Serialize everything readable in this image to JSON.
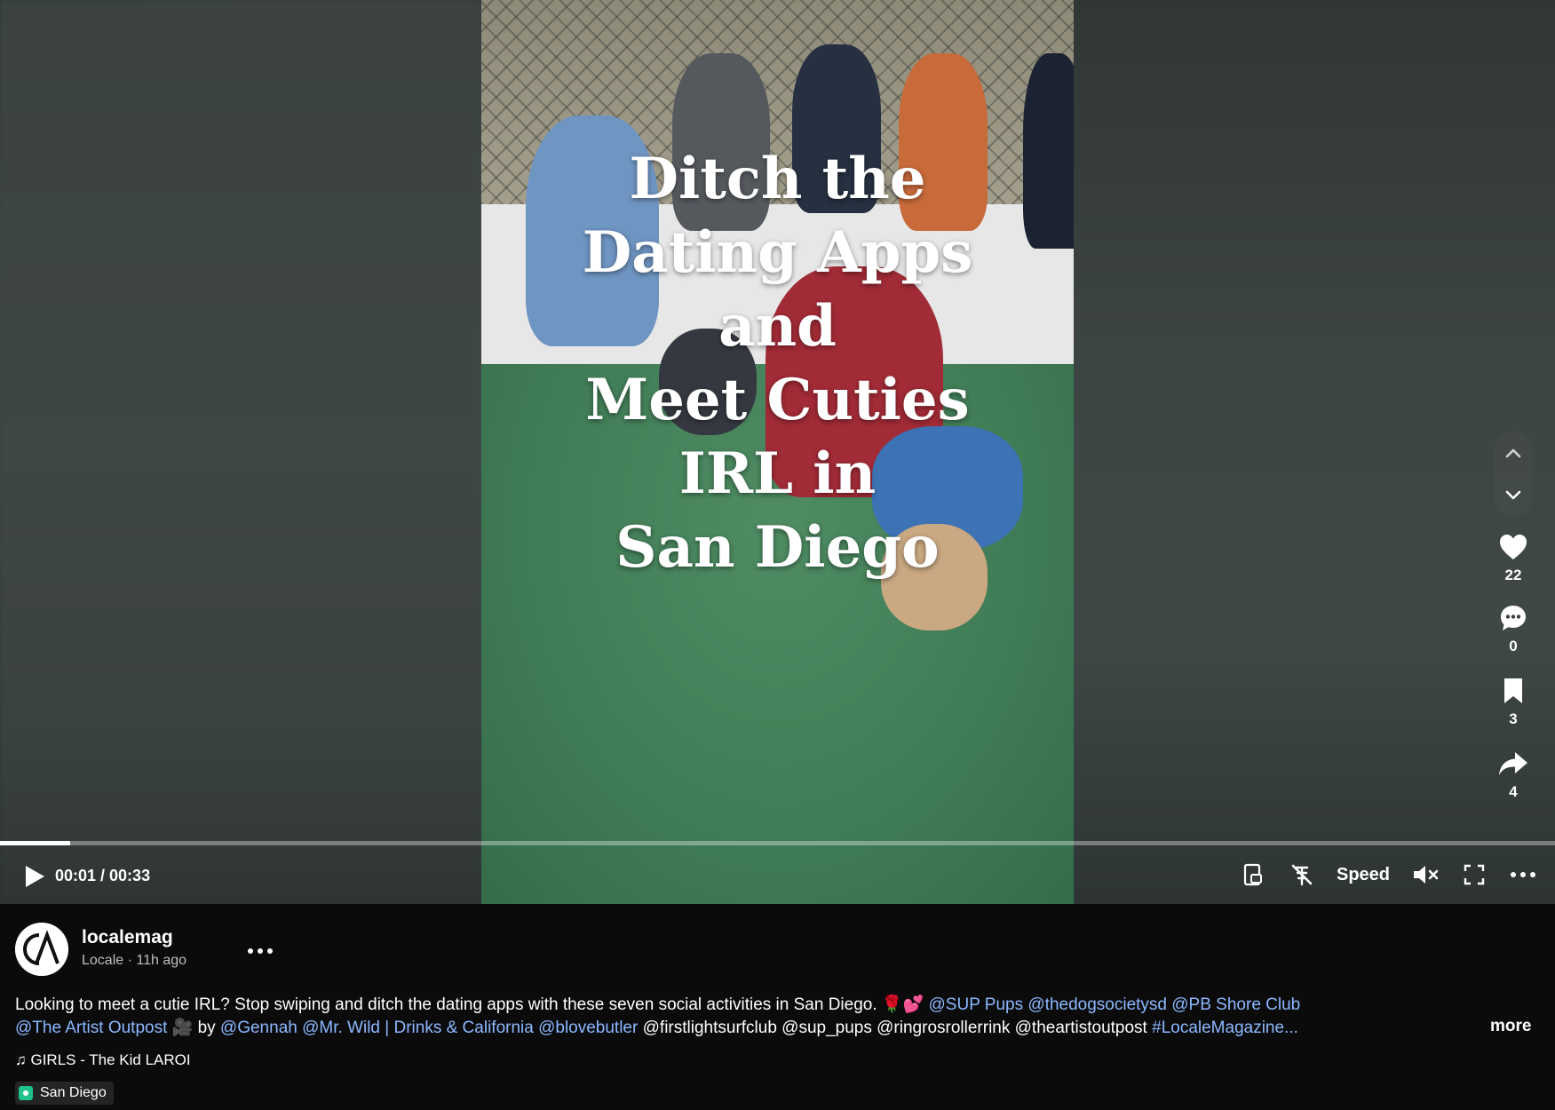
{
  "video": {
    "overlay_lines": [
      "Ditch the",
      "Dating Apps",
      "and",
      "Meet Cuties",
      "IRL in",
      "San Diego"
    ]
  },
  "actions": {
    "likes": "22",
    "comments": "0",
    "saves": "3",
    "shares": "4"
  },
  "player": {
    "time": "00:01 / 00:33",
    "speed_label": "Speed",
    "progress_fraction": 0.045
  },
  "post": {
    "username": "localemag",
    "subline": "Locale · 11h ago",
    "caption_line1_text": "Looking to meet a cutie IRL? Stop swiping and ditch the dating apps with these seven social activities in San Diego. 🌹💕 ",
    "caption_line1_mentions": "@SUP Pups @thedogsocietysd @PB Shore Club",
    "caption_line2_mention_a": "@The  Artist  Outpost",
    "caption_line2_text_a": " 🎥 by ",
    "caption_line2_mention_b": "@Gennah @Mr. Wild | Drinks & California @blovebutler",
    "caption_line2_text_b": " @firstlightsurfclub @sup_pups @ringrosrollerrink @theartistoutpost ",
    "caption_line2_tag": "#LocaleMagazine...",
    "more_label": "more",
    "music": "♫ GIRLS - The Kid LAROI",
    "location": "San Diego"
  },
  "icons": [
    "chevron-up-icon",
    "chevron-down-icon",
    "heart-icon",
    "comment-icon",
    "bookmark-icon",
    "share-icon",
    "play-icon",
    "pip-icon",
    "no-autoscroll-icon",
    "mute-icon",
    "fullscreen-icon",
    "more-icon"
  ]
}
